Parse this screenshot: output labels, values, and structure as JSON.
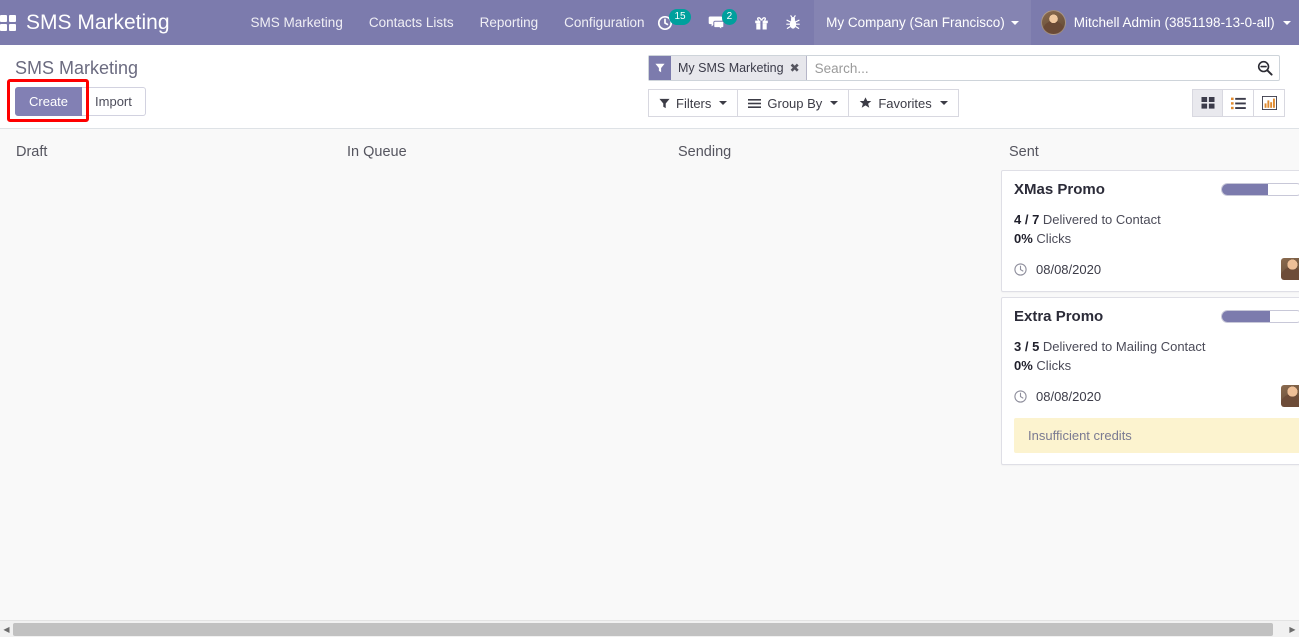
{
  "navbar": {
    "apps_icon": "apps-grid-icon",
    "brand": "SMS Marketing",
    "menus": [
      {
        "label": "SMS Marketing"
      },
      {
        "label": "Contacts Lists"
      },
      {
        "label": "Reporting"
      },
      {
        "label": "Configuration"
      }
    ],
    "sys_icons": [
      {
        "name": "activity-clock-icon",
        "badge": "15"
      },
      {
        "name": "messages-bubble-icon",
        "badge": "2"
      },
      {
        "name": "gift-icon",
        "badge": ""
      },
      {
        "name": "bug-icon",
        "badge": ""
      }
    ],
    "company": "My Company (San Francisco)",
    "user": "Mitchell Admin (3851198-13-0-all)"
  },
  "control_panel": {
    "breadcrumb": "SMS Marketing",
    "create_label": "Create",
    "import_label": "Import",
    "highlight_color": "#ff0000",
    "search": {
      "facet_label": "My SMS Marketing",
      "facet_icon": "filter-funnel-icon",
      "facet_remove_icon": "remove-facet-icon",
      "placeholder": "Search...",
      "value": "",
      "search_icon": "search-minus-icon"
    },
    "buttons": [
      {
        "label": "Filters",
        "icon": "filter-funnel-icon"
      },
      {
        "label": "Group By",
        "icon": "hamburger-lines-icon"
      },
      {
        "label": "Favorites",
        "icon": "star-icon"
      }
    ],
    "views": [
      {
        "name": "kanban-view-icon",
        "active": true
      },
      {
        "name": "list-view-icon",
        "active": false
      },
      {
        "name": "graph-view-icon",
        "active": false
      }
    ]
  },
  "kanban": {
    "columns": [
      {
        "title": "Draft",
        "cards": []
      },
      {
        "title": "In Queue",
        "cards": []
      },
      {
        "title": "Sending",
        "cards": []
      },
      {
        "title": "Sent",
        "cards": [
          {
            "title": "XMas Promo",
            "progress_percent": 57,
            "delivered_ratio": "4 / 7",
            "delivered_label": "Delivered to Contact",
            "clicks_value": "0%",
            "clicks_label": "Clicks",
            "date_icon": "clock-icon",
            "date": "08/08/2020",
            "avatar": "user-avatar",
            "alert": ""
          },
          {
            "title": "Extra Promo",
            "progress_percent": 60,
            "delivered_ratio": "3 / 5",
            "delivered_label": "Delivered to Mailing Contact",
            "clicks_value": "0%",
            "clicks_label": "Clicks",
            "date_icon": "clock-icon",
            "date": "08/08/2020",
            "avatar": "user-avatar",
            "alert": "Insufficient credits"
          }
        ]
      }
    ]
  },
  "colors": {
    "brand_purple": "#7c7bad",
    "progress_fill": "#7c7bad",
    "badge_teal": "#00a09d",
    "alert_bg": "#fcf3cf",
    "highlight_red": "#ff0000"
  },
  "scrollbar": {
    "left_arrow": "scroll-left-arrow",
    "right_arrow": "scroll-right-arrow"
  }
}
